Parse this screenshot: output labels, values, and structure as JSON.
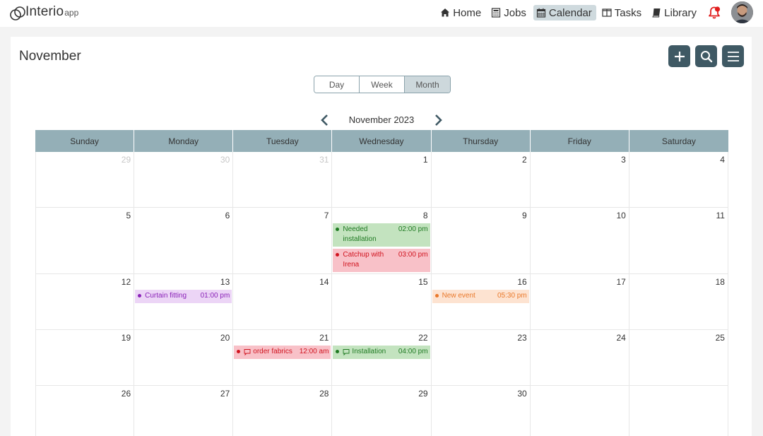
{
  "app": {
    "brand": "Interio",
    "brand_sub": "app"
  },
  "nav": [
    {
      "label": "Home",
      "icon": "home-icon"
    },
    {
      "label": "Jobs",
      "icon": "calculator-icon"
    },
    {
      "label": "Calendar",
      "icon": "calendar-icon",
      "active": true
    },
    {
      "label": "Tasks",
      "icon": "columns-icon"
    },
    {
      "label": "Library",
      "icon": "book-icon"
    }
  ],
  "page": {
    "title": "November"
  },
  "views": [
    {
      "label": "Day"
    },
    {
      "label": "Week"
    },
    {
      "label": "Month",
      "active": true
    }
  ],
  "calendar": {
    "month_label": "November 2023",
    "weekdays": [
      "Sunday",
      "Monday",
      "Tuesday",
      "Wednesday",
      "Thursday",
      "Friday",
      "Saturday"
    ],
    "weeks": [
      [
        {
          "n": "29",
          "other": true
        },
        {
          "n": "30",
          "other": true
        },
        {
          "n": "31",
          "other": true
        },
        {
          "n": "1"
        },
        {
          "n": "2"
        },
        {
          "n": "3"
        },
        {
          "n": "4"
        }
      ],
      [
        {
          "n": "5"
        },
        {
          "n": "6"
        },
        {
          "n": "7"
        },
        {
          "n": "8",
          "events": [
            {
              "title": "Needed installation",
              "time": "02:00 pm",
              "color": "green"
            },
            {
              "title": "Catchup with Irena",
              "time": "03:00 pm",
              "color": "red"
            }
          ]
        },
        {
          "n": "9"
        },
        {
          "n": "10"
        },
        {
          "n": "11"
        }
      ],
      [
        {
          "n": "12"
        },
        {
          "n": "13",
          "events": [
            {
              "title": "Curtain fitting",
              "time": "01:00 pm",
              "color": "purple"
            }
          ]
        },
        {
          "n": "14"
        },
        {
          "n": "15"
        },
        {
          "n": "16",
          "events": [
            {
              "title": "New event",
              "time": "05:30 pm",
              "color": "orange"
            }
          ]
        },
        {
          "n": "17"
        },
        {
          "n": "18"
        }
      ],
      [
        {
          "n": "19"
        },
        {
          "n": "20"
        },
        {
          "n": "21",
          "events": [
            {
              "title": "order fabrics",
              "time": "12:00 am",
              "color": "red",
              "comment": true
            }
          ]
        },
        {
          "n": "22",
          "events": [
            {
              "title": "Installation",
              "time": "04:00 pm",
              "color": "green",
              "comment": true
            }
          ]
        },
        {
          "n": "23"
        },
        {
          "n": "24"
        },
        {
          "n": "25"
        }
      ],
      [
        {
          "n": "26"
        },
        {
          "n": "27"
        },
        {
          "n": "28"
        },
        {
          "n": "29"
        },
        {
          "n": "30"
        },
        {
          "n": ""
        },
        {
          "n": ""
        }
      ]
    ]
  },
  "colors": {
    "accent": "#3f5964",
    "header_bg": "#94afb7",
    "green": {
      "bg": "#c3e3bf",
      "fg": "#1f7a22",
      "dot": "#1f7a22"
    },
    "red": {
      "bg": "#f8c1c8",
      "fg": "#d0141f",
      "dot": "#d0141f"
    },
    "purple": {
      "bg": "#ecd5f6",
      "fg": "#8a22b8",
      "dot": "#8a22b8"
    },
    "orange": {
      "bg": "#fde3d1",
      "fg": "#e9782a",
      "dot": "#e9782a"
    }
  }
}
